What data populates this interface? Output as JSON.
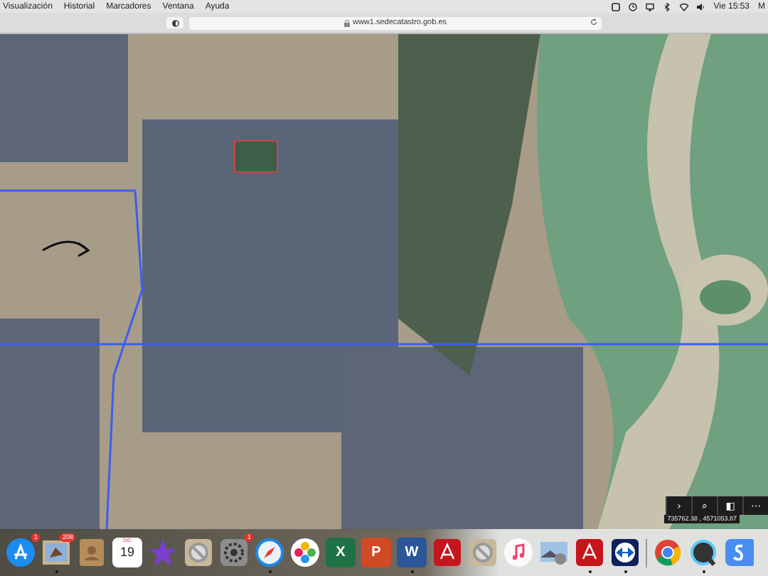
{
  "menu_bar": {
    "items": [
      "Visualización",
      "Historial",
      "Marcadores",
      "Ventana",
      "Ayuda"
    ],
    "clock": "Vie 15:53",
    "cut_item": "M"
  },
  "browser": {
    "url": "www1.sedecatastro.gob.es"
  },
  "map": {
    "tools": [
      "›",
      "⌕",
      "◧",
      "⋯"
    ],
    "coordinates": "735762.38 , 4571053.87"
  },
  "dock": [
    {
      "kind": "appstore",
      "running": false,
      "badge": "1"
    },
    {
      "kind": "preview",
      "running": true,
      "badge": "208"
    },
    {
      "kind": "contacts",
      "running": false
    },
    {
      "kind": "calendar",
      "running": false,
      "month": "DIC",
      "day": "19"
    },
    {
      "kind": "imovie",
      "running": false
    },
    {
      "kind": "blocked",
      "running": false
    },
    {
      "kind": "settings",
      "running": false,
      "badge": "1"
    },
    {
      "kind": "safari",
      "running": true
    },
    {
      "kind": "photos",
      "running": false
    },
    {
      "kind": "letter",
      "running": false,
      "glyph": "X",
      "color": "#1f7244"
    },
    {
      "kind": "letter",
      "running": false,
      "glyph": "P",
      "color": "#d04a26"
    },
    {
      "kind": "letter",
      "running": true,
      "glyph": "W",
      "color": "#2b579a"
    },
    {
      "kind": "acrobat",
      "running": false
    },
    {
      "kind": "blocked",
      "running": false
    },
    {
      "kind": "music",
      "running": false
    },
    {
      "kind": "viewer",
      "running": false
    },
    {
      "kind": "acrobat",
      "running": true
    },
    {
      "kind": "teamviewer",
      "running": true
    },
    {
      "kind": "chrome",
      "running": false
    },
    {
      "kind": "quicktime",
      "running": true
    },
    {
      "kind": "sapp",
      "running": false
    }
  ]
}
